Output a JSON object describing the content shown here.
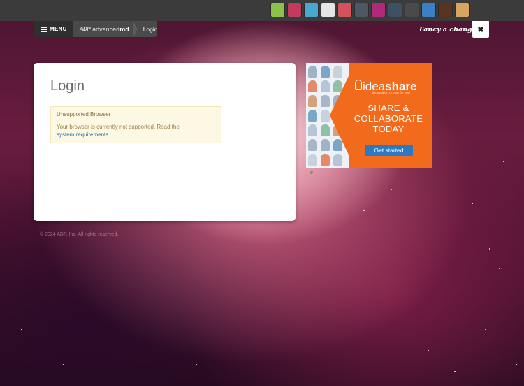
{
  "theme_swatches": [
    {
      "name": "green-leaves-theme",
      "color": "#8ac24a"
    },
    {
      "name": "berry-theme",
      "color": "#c23a5e"
    },
    {
      "name": "ocean-theme",
      "color": "#4aa8cf"
    },
    {
      "name": "white-theme",
      "color": "#e6e6e6"
    },
    {
      "name": "red-mosaic-theme",
      "color": "#d4525a"
    },
    {
      "name": "slate-theme",
      "color": "#4d5863"
    },
    {
      "name": "magenta-theme",
      "color": "#b02a7a"
    },
    {
      "name": "dark-steel-theme",
      "color": "#3e5066"
    },
    {
      "name": "charcoal-theme",
      "color": "#4a4a4a"
    },
    {
      "name": "blue-theme",
      "color": "#3b7fc4"
    },
    {
      "name": "wood-theme",
      "color": "#5a3320"
    },
    {
      "name": "sand-theme",
      "color": "#d8a560"
    }
  ],
  "breadcrumb": {
    "menu_label": "MENU",
    "logo_prefix": "ADP",
    "logo_text": "advanced",
    "logo_bold": "md",
    "page": "Login"
  },
  "fancy_text": "Fancy a change?",
  "close_symbol": "✖",
  "login": {
    "title": "Login",
    "alert_title": "Unsupported Browser",
    "alert_text": "Your browser is currently not supported. Read the",
    "alert_link": "system requirements",
    "alert_end": "."
  },
  "copyright": "© 2024 ADP, Inc. All rights reserved.",
  "ad": {
    "brand_light": "idea",
    "brand_bold": "share",
    "tagline": "innovation driven by you",
    "headline_1": "SHARE &",
    "headline_2": "COLLABORATE",
    "headline_3": "TODAY",
    "cta": "Get started"
  }
}
